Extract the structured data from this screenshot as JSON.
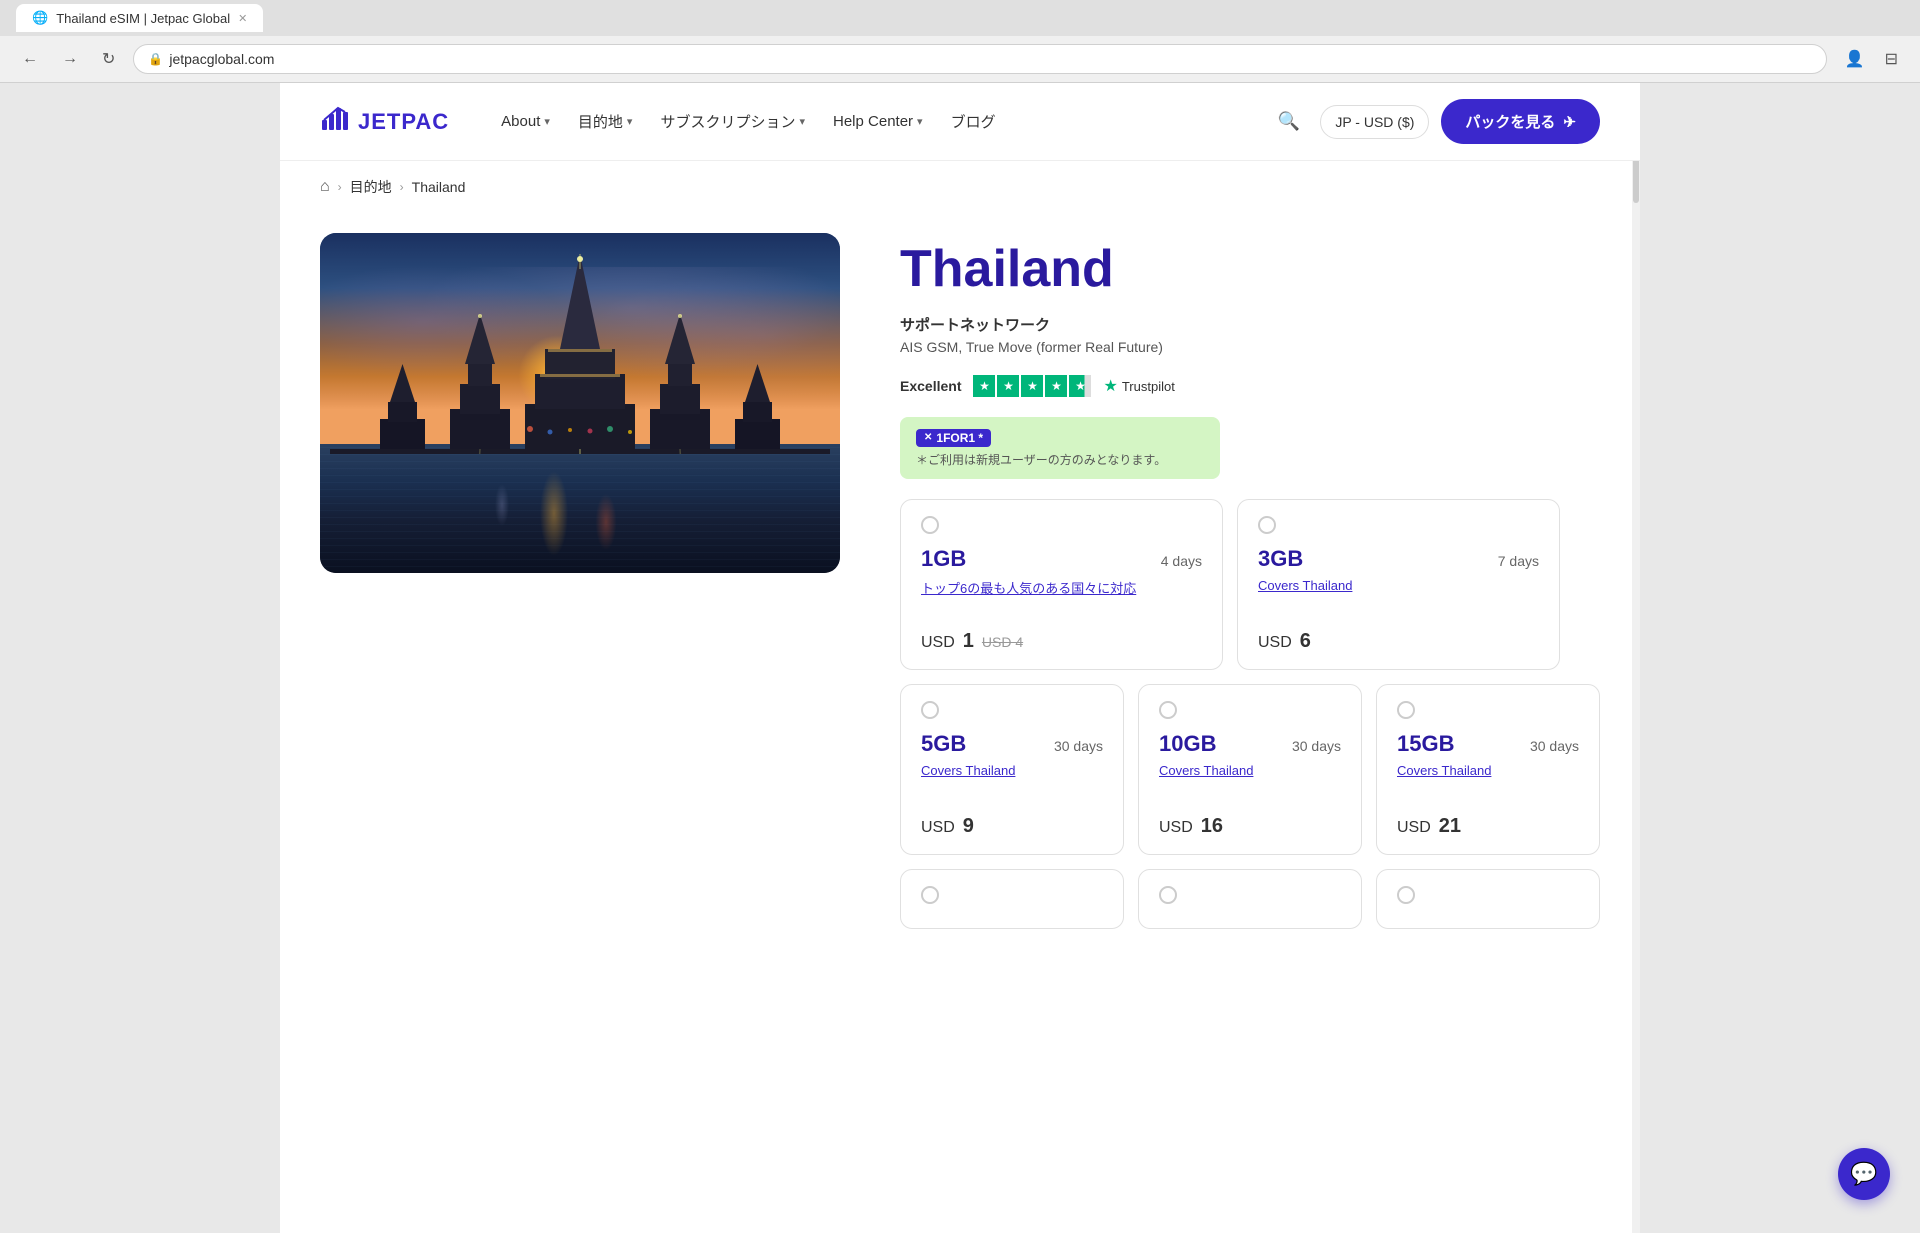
{
  "browser": {
    "url": "jetpacglobal.com",
    "tab_label": "Thailand eSIM | Jetpac Global"
  },
  "navbar": {
    "logo_text": "JETPAC",
    "nav_items": [
      {
        "label": "About",
        "has_dropdown": true
      },
      {
        "label": "目的地",
        "has_dropdown": true
      },
      {
        "label": "サブスクリプション",
        "has_dropdown": true
      },
      {
        "label": "Help Center",
        "has_dropdown": true
      },
      {
        "label": "ブログ",
        "has_dropdown": false
      }
    ],
    "lang_btn": "JP - USD ($)",
    "cta_btn": "パックを見る",
    "cta_icon": "✈"
  },
  "breadcrumb": {
    "home_icon": "⌂",
    "items": [
      {
        "label": "目的地",
        "link": true
      },
      {
        "label": "Thailand",
        "link": false
      }
    ]
  },
  "destination": {
    "title": "Thailand",
    "network_label": "サポートネットワーク",
    "network_names": "AIS GSM, True Move (former Real Future)",
    "trustpilot_label": "Excellent",
    "trustpilot_logo": "Trustpilot"
  },
  "promo": {
    "badge": "1FOR1 *",
    "badge_icon": "✕",
    "text": "＊ご利用は新規ユーザーの方のみとなります。"
  },
  "plans": {
    "row1": [
      {
        "size": "1GB",
        "days": "4 days",
        "coverage_text": "トップ6の最も人気のある国々に対応",
        "price_label": "USD",
        "price": "1",
        "original_price": "USD 4",
        "has_original": true
      },
      {
        "size": "3GB",
        "days": "7 days",
        "coverage_text": "Covers Thailand",
        "price_label": "USD",
        "price": "6",
        "has_original": false
      }
    ],
    "row2": [
      {
        "size": "5GB",
        "days": "30 days",
        "coverage_text": "Covers Thailand",
        "price_label": "USD",
        "price": "9",
        "has_original": false
      },
      {
        "size": "10GB",
        "days": "30 days",
        "coverage_text": "Covers Thailand",
        "price_label": "USD",
        "price": "16",
        "has_original": false
      },
      {
        "size": "15GB",
        "days": "30 days",
        "coverage_text": "Covers Thailand",
        "price_label": "USD",
        "price": "21",
        "has_original": false
      }
    ]
  },
  "colors": {
    "brand_primary": "#3B28CC",
    "brand_dark": "#2a1a9e",
    "text_dark": "#333",
    "promo_bg": "#d4f5c4",
    "trustpilot_green": "#00B67A"
  }
}
